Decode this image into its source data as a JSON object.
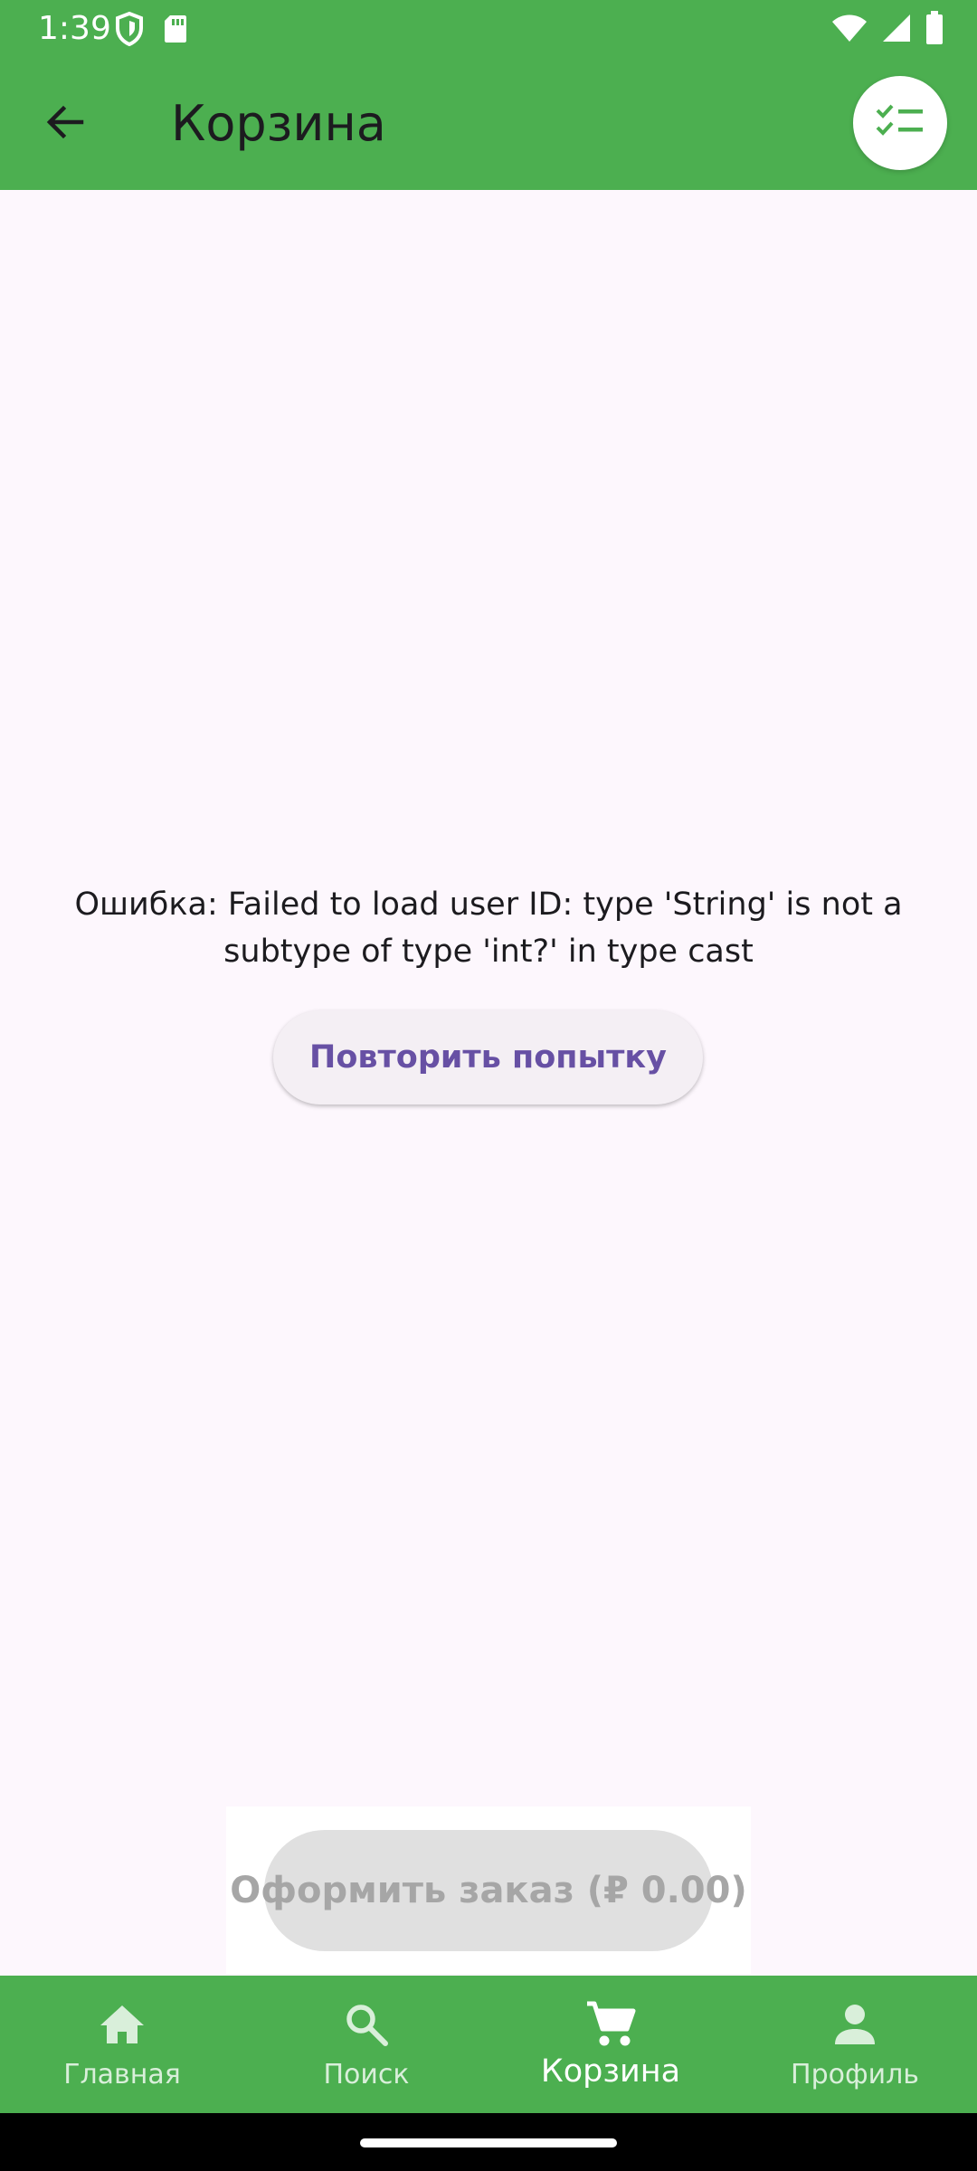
{
  "status_bar": {
    "time": "1:39",
    "icons": [
      "shield-icon",
      "sd-card-icon",
      "wifi-icon",
      "cellular-signal-icon",
      "battery-icon"
    ]
  },
  "app_bar": {
    "title": "Корзина",
    "back_icon": "arrow-back-icon",
    "action_icon": "checklist-icon"
  },
  "content": {
    "error_message": "Ошибка: Failed to load user ID: type 'String' is not a subtype of type 'int?' in type cast",
    "retry_label": "Повторить попытку",
    "checkout_label": "Оформить заказ (₽ 0.00)"
  },
  "bottom_nav": {
    "items": [
      {
        "label": "Главная",
        "icon": "home-icon"
      },
      {
        "label": "Поиск",
        "icon": "search-icon"
      },
      {
        "label": "Корзина",
        "icon": "cart-icon",
        "active": true
      },
      {
        "label": "Профиль",
        "icon": "person-icon"
      }
    ]
  },
  "colors": {
    "primary": "#4caf50",
    "background": "#fdf7fd",
    "accent_text": "#6750a4",
    "disabled_button": "#e0e0e0"
  }
}
